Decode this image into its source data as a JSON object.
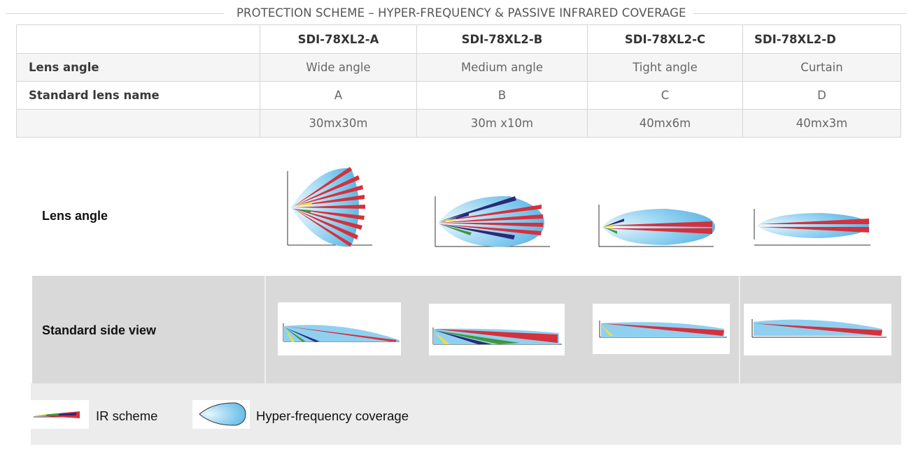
{
  "title": "PROTECTION SCHEME – HYPER-FREQUENCY & PASSIVE INFRARED COVERAGE",
  "table": {
    "header": [
      "",
      "SDI-78XL2-A",
      "SDI-78XL2-B",
      "SDI-78XL2-C",
      "SDI-78XL2-D"
    ],
    "rows": [
      {
        "label": "Lens angle",
        "values": [
          "Wide angle",
          "Medium angle",
          "Tight angle",
          "Curtain"
        ]
      },
      {
        "label": "Standard lens name",
        "values": [
          "A",
          "B",
          "C",
          "D"
        ]
      },
      {
        "label": "",
        "values": [
          "30mx30m",
          "30m x10m",
          "40mx6m",
          "40mx3m"
        ]
      }
    ]
  },
  "diagram": {
    "row_labels": {
      "lens_angle": "Lens angle",
      "side_view": "Standard side view"
    },
    "legend": {
      "ir": "IR scheme",
      "hf": "Hyper-frequency coverage"
    },
    "colors": {
      "ir_red": "#d6303c",
      "ir_navy": "#2a2a7a",
      "ir_green": "#3a9a3a",
      "ir_yellow": "#e8e040",
      "hf_blue": "#6cc0e8"
    }
  }
}
